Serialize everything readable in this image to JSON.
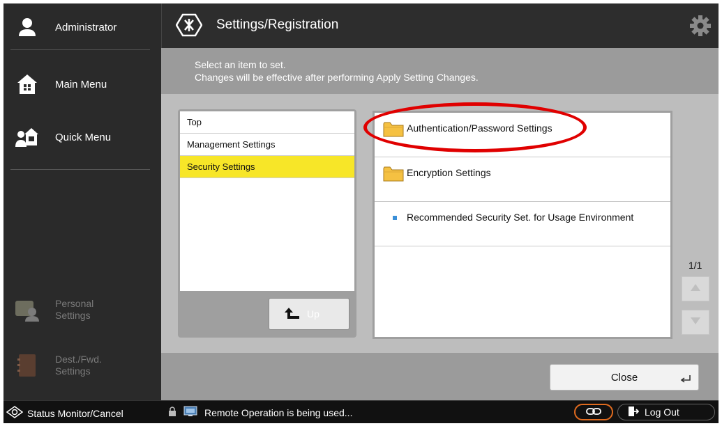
{
  "sidebar": {
    "user_label": "Administrator",
    "main_menu_label": "Main Menu",
    "quick_menu_label": "Quick Menu",
    "personal_settings": [
      "Personal",
      "Settings"
    ],
    "dest_fwd_settings": [
      "Dest./Fwd.",
      "Settings"
    ]
  },
  "header": {
    "title": "Settings/Registration"
  },
  "message": {
    "line1": "Select an item to set.",
    "line2": "Changes will be effective after performing Apply Setting Changes."
  },
  "tree": {
    "items": [
      "Top",
      "Management Settings",
      "Security Settings"
    ],
    "selected_index": 2,
    "up_label": "Up"
  },
  "list": {
    "items": [
      {
        "type": "folder",
        "label": "Authentication/Password Settings"
      },
      {
        "type": "folder",
        "label": "Encryption Settings"
      },
      {
        "type": "item",
        "label": "Recommended Security Set. for Usage Environment"
      }
    ]
  },
  "pager": {
    "text": "1/1"
  },
  "actions": {
    "close_label": "Close"
  },
  "statusbar": {
    "status_monitor_label": "Status Monitor/Cancel",
    "remote_text": "Remote Operation is being used...",
    "logout_label": "Log Out"
  },
  "colors": {
    "selected_highlight": "#f7e628",
    "annotation_circle": "#e00000",
    "link_pill_border": "#e06b1f"
  },
  "icons": {
    "user": "user-icon",
    "main_menu": "home-icon",
    "quick_menu": "quick-menu-icon",
    "settings_header": "settings-registration-icon",
    "gear": "gear-icon",
    "folder": "folder-icon",
    "up_arrow": "up-arrow-icon",
    "status_monitor": "status-monitor-icon",
    "remote": "remote-operation-icon",
    "link": "link-icon",
    "logout": "logout-icon"
  }
}
